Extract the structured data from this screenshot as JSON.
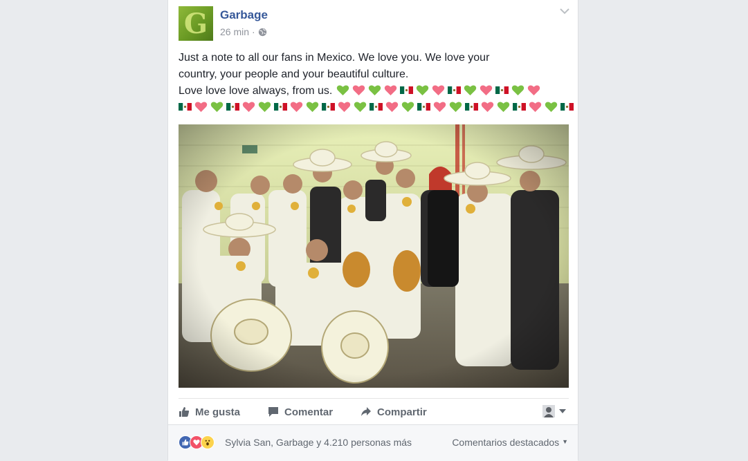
{
  "post": {
    "page_name": "Garbage",
    "timestamp": "26 min",
    "separator": "·",
    "text_line1": "Just a note to all our fans in Mexico. We love you. We love your",
    "text_line2": "country, your people and your beautiful culture.",
    "text_line3": "Love love love always, from us."
  },
  "emoji_line1": [
    "green-heart",
    "pink-heart",
    "green-heart",
    "pink-heart",
    "mexico-flag",
    "green-heart",
    "pink-heart",
    "mexico-flag",
    "green-heart",
    "pink-heart",
    "mexico-flag",
    "green-heart",
    "pink-heart"
  ],
  "emoji_line2": [
    "mexico-flag",
    "pink-heart",
    "green-heart",
    "mexico-flag",
    "pink-heart",
    "green-heart",
    "mexico-flag",
    "pink-heart",
    "green-heart",
    "mexico-flag",
    "pink-heart",
    "green-heart",
    "mexico-flag",
    "pink-heart",
    "green-heart",
    "mexico-flag",
    "pink-heart",
    "green-heart",
    "mexico-flag",
    "pink-heart",
    "green-heart",
    "mexico-flag",
    "pink-heart",
    "green-heart",
    "mexico-flag"
  ],
  "actions": {
    "like": "Me gusta",
    "comment": "Comentar",
    "share": "Compartir"
  },
  "reactions": {
    "icons": [
      "like-reaction-icon",
      "love-reaction-icon",
      "wow-reaction-icon"
    ],
    "summary": "Sylvia San, Garbage y 4.210 personas más",
    "comments_sort": "Comentarios destacados"
  },
  "colors": {
    "link_blue": "#365899",
    "green_heart": "#7ac143",
    "pink_heart": "#f26d85",
    "flag_green": "#006847",
    "flag_red": "#ce1126"
  }
}
